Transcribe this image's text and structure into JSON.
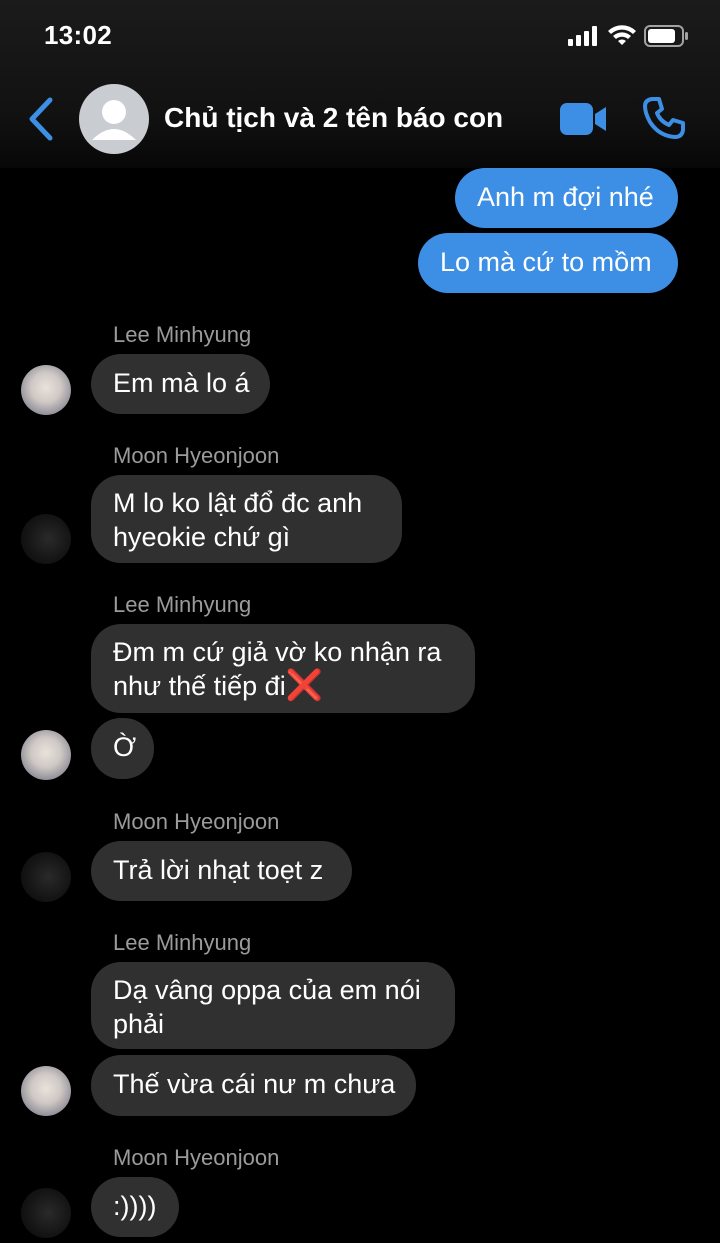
{
  "status_bar": {
    "time": "13:02"
  },
  "header": {
    "title": "Chủ tịch và 2 tên báo con"
  },
  "messages": {
    "m1": "Anh m đợi nhé",
    "m2": "Lo mà cứ to mồm",
    "n1": "Lee Minhyung",
    "m3": "Em mà lo á",
    "n2": "Moon Hyeonjoon",
    "m4a": "M lo ko lật đổ đc anh",
    "m4b": "hyeokie chứ gì",
    "n3": "Lee Minhyung",
    "m5a": "Đm m cứ giả vờ ko nhận ra",
    "m5b": "như thế tiếp đi",
    "m5_emoji": "❌",
    "m6": "Ờ",
    "n4": "Moon Hyeonjoon",
    "m7": "Trả lời nhạt toẹt z",
    "n5": "Lee Minhyung",
    "m8a": "Dạ vâng oppa của em nói",
    "m8b": "phải",
    "m9": "Thế vừa cái nư m chưa",
    "n6": "Moon Hyeonjoon",
    "m10": ":))))"
  },
  "colors": {
    "accent": "#3c8fe4",
    "incoming_bubble": "#303030",
    "background": "#000000"
  },
  "icons": [
    "back-chevron-icon",
    "group-avatar-icon",
    "video-call-icon",
    "phone-call-icon",
    "signal-icon",
    "wifi-icon",
    "battery-icon"
  ]
}
